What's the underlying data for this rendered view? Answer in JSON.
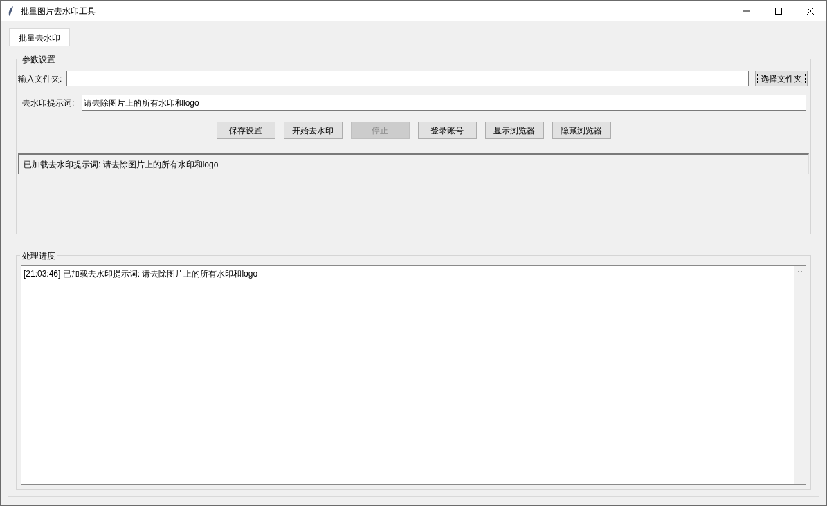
{
  "window": {
    "title": "批量图片去水印工具"
  },
  "tabs": [
    {
      "label": "批量去水印",
      "selected": true
    }
  ],
  "settings": {
    "title": "参数设置",
    "folder": {
      "label": "输入文件夹:",
      "button": {
        "label": "选择文件夹",
        "focused": true
      }
    },
    "prompt": {
      "label": "去水印提示词:",
      "value": "请去除图片上的所有水印和logo"
    },
    "buttons": [
      {
        "label": "保存设置",
        "disabled": false
      },
      {
        "label": "开始去水印",
        "disabled": false
      },
      {
        "label": "停止",
        "disabled": true
      },
      {
        "label": "登录账号",
        "disabled": false
      },
      {
        "label": "显示浏览器",
        "disabled": false
      },
      {
        "label": "隐藏浏览器",
        "disabled": false
      }
    ],
    "status": "已加载去水印提示词: 请去除图片上的所有水印和logo"
  },
  "progress": {
    "title": "处理进度",
    "log": [
      "[21:03:46] 已加载去水印提示词: 请去除图片上的所有水印和logo"
    ]
  }
}
